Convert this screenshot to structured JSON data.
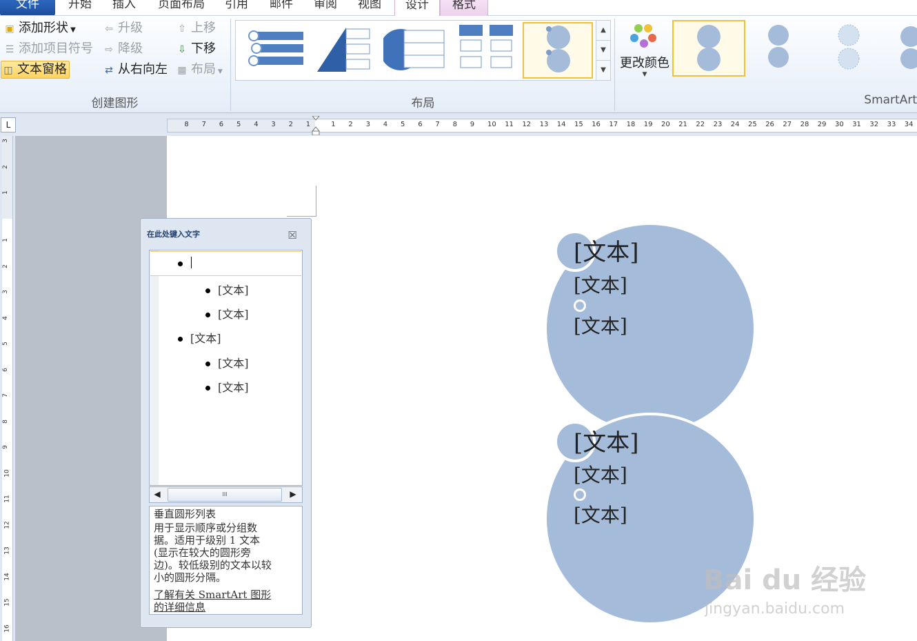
{
  "tabs": {
    "file": "文件",
    "home": "开始",
    "insert": "插入",
    "page_layout": "页面布局",
    "references": "引用",
    "mailings": "邮件",
    "review": "审阅",
    "view": "视图",
    "design": "设计",
    "format": "格式"
  },
  "ribbon": {
    "create_graphic": {
      "add_shape": "添加形状",
      "add_bullet": "添加项目符号",
      "text_pane": "文本窗格",
      "promote": "升级",
      "demote": "降级",
      "right_to_left": "从右向左",
      "move_up": "上移",
      "move_down": "下移",
      "layout": "布局",
      "label": "创建图形"
    },
    "layouts": {
      "label": "布局"
    },
    "styles": {
      "change_colors": "更改颜色",
      "label": "SmartArt"
    }
  },
  "ruler": {
    "h_left": [
      "8",
      "7",
      "6",
      "5",
      "4",
      "3",
      "2",
      "1"
    ],
    "h_right": [
      "1",
      "2",
      "3",
      "4",
      "5",
      "6",
      "7",
      "8",
      "9",
      "10",
      "11",
      "12",
      "13",
      "14",
      "15",
      "16",
      "17",
      "18",
      "19",
      "20",
      "21",
      "22",
      "23",
      "24",
      "25",
      "26",
      "27",
      "28",
      "29",
      "30",
      "31",
      "32",
      "33",
      "34"
    ],
    "v_top": [
      "3",
      "2",
      "1"
    ],
    "v_main": [
      "1",
      "2",
      "3",
      "4",
      "5",
      "6",
      "7",
      "8",
      "9",
      "10",
      "11",
      "12",
      "13",
      "14",
      "15",
      "16"
    ]
  },
  "text_pane": {
    "title": "在此处键入文字",
    "items": [
      {
        "level": 1,
        "text": ""
      },
      {
        "level": 2,
        "text": "[文本]"
      },
      {
        "level": 2,
        "text": "[文本]"
      },
      {
        "level": 1,
        "text": "[文本]"
      },
      {
        "level": 2,
        "text": "[文本]"
      },
      {
        "level": 2,
        "text": "[文本]"
      }
    ],
    "scroll_thumb": "III",
    "description": {
      "title": "垂直圆形列表",
      "lines": [
        "用于显示顺序或分组数",
        "据。适用于级别 1 文本",
        "(显示在较大的圆形旁",
        "边)。较低级别的文本以较",
        "小的圆形分隔。"
      ],
      "link_lines": [
        "了解有关 SmartArt 图形",
        "的详细信息"
      ]
    }
  },
  "smartart": {
    "block1": {
      "title": "[文本]",
      "line1": "[文本]",
      "line2": "[文本]"
    },
    "block2": {
      "title": "[文本]",
      "line1": "[文本]",
      "line2": "[文本]"
    }
  },
  "watermark": {
    "brand": "Bai du 经验",
    "url": "jingyan.baidu.com"
  },
  "colors": {
    "circle_fill": "#a4bcda",
    "accent_blue": "#1c4f9e"
  }
}
